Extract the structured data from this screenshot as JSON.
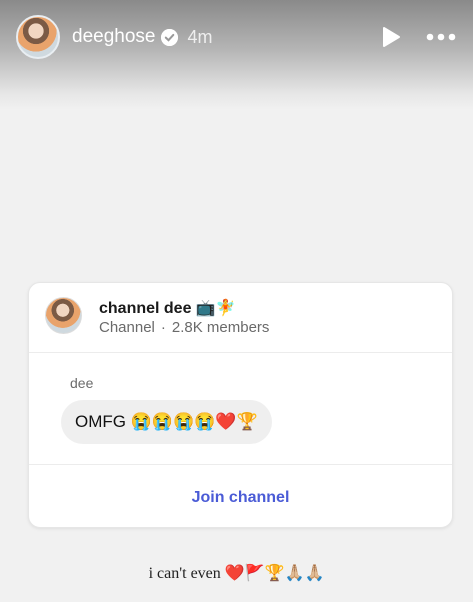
{
  "header": {
    "username": "deeghose",
    "time": "4m",
    "icons": {
      "verified": "verified-badge-icon",
      "play": "play-icon",
      "more": "more-dots-icon"
    }
  },
  "card": {
    "channel_name": "channel dee 📺🧚",
    "channel_type": "Channel",
    "separator": "·",
    "members": "2.8K members",
    "sender": "dee",
    "message": "OMFG 😭😭😭😭❤️🏆",
    "join_label": "Join channel",
    "accent_color": "#4a5bd6"
  },
  "caption": "i can't even ❤️🚩🏆🙏🏼🙏🏼"
}
